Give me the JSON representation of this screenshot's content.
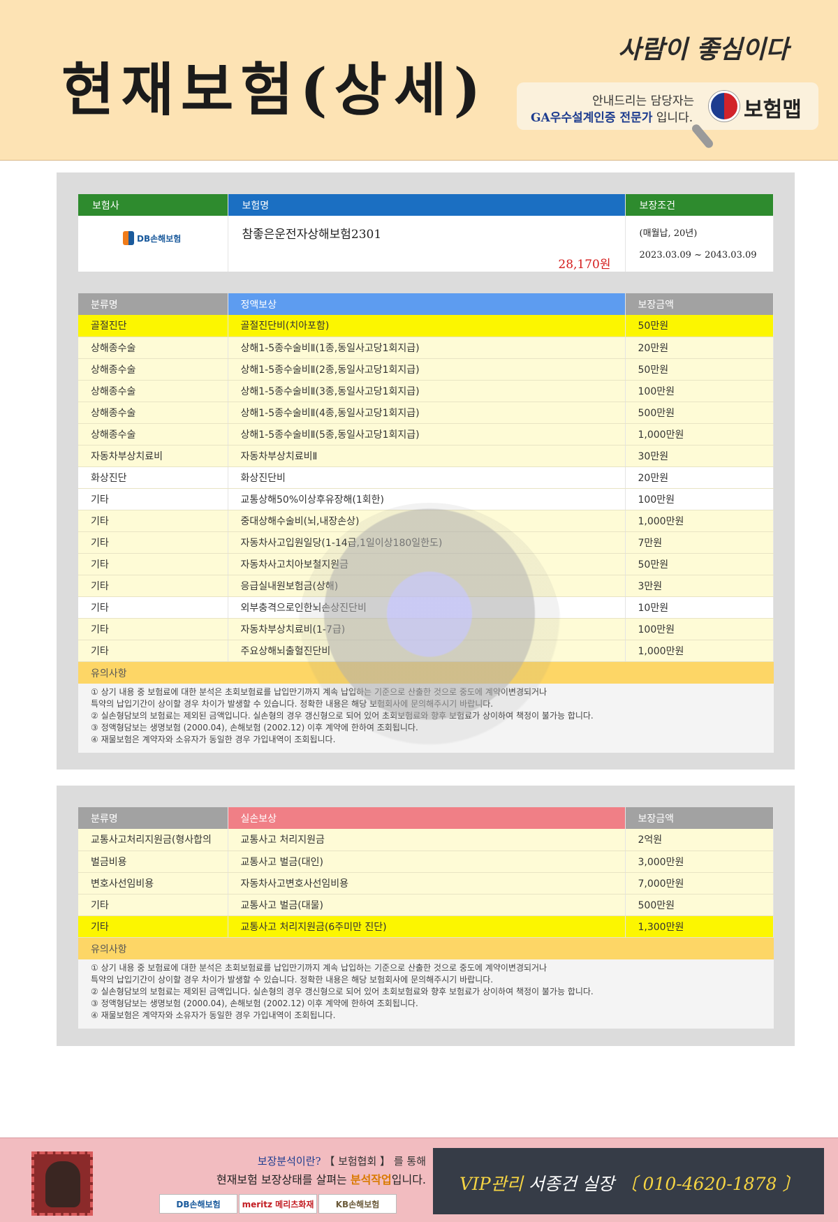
{
  "header": {
    "title": "현재보험(상세)",
    "slogan": "사람이 좋심이다",
    "agent_line1": "안내드리는 담당자는",
    "agent_line2_highlight": "GA우수설계인증 전문가",
    "agent_line2_tail": " 입니다.",
    "brand_name": "보험맵"
  },
  "policy": {
    "headers": {
      "company": "보험사",
      "product": "보험명",
      "terms": "보장조건"
    },
    "company_logo_text": "DB손해보험",
    "product_name": "참좋은운전자상해보험2301",
    "premium": "28,170원",
    "terms_payment": "(매월납, 20년)",
    "terms_period": "2023.03.09 ~ 2043.03.09"
  },
  "fixed_coverage": {
    "headers": {
      "category": "분류명",
      "coverage": "정액보상",
      "amount": "보장금액"
    },
    "rows": [
      {
        "category": "골절진단",
        "coverage": "골절진단비(치아포함)",
        "amount": "50만원",
        "style": "yellow"
      },
      {
        "category": "상해종수술",
        "coverage": "상해1-5종수술비Ⅱ(1종,동일사고당1회지급)",
        "amount": "20만원",
        "style": "light"
      },
      {
        "category": "상해종수술",
        "coverage": "상해1-5종수술비Ⅱ(2종,동일사고당1회지급)",
        "amount": "50만원",
        "style": "light"
      },
      {
        "category": "상해종수술",
        "coverage": "상해1-5종수술비Ⅱ(3종,동일사고당1회지급)",
        "amount": "100만원",
        "style": "light"
      },
      {
        "category": "상해종수술",
        "coverage": "상해1-5종수술비Ⅱ(4종,동일사고당1회지급)",
        "amount": "500만원",
        "style": "light"
      },
      {
        "category": "상해종수술",
        "coverage": "상해1-5종수술비Ⅱ(5종,동일사고당1회지급)",
        "amount": "1,000만원",
        "style": "light"
      },
      {
        "category": "자동차부상치료비",
        "coverage": "자동차부상치료비Ⅱ",
        "amount": "30만원",
        "style": "light"
      },
      {
        "category": "화상진단",
        "coverage": "화상진단비",
        "amount": "20만원",
        "style": "white"
      },
      {
        "category": "기타",
        "coverage": "교통상해50%이상후유장해(1회한)",
        "amount": "100만원",
        "style": "white"
      },
      {
        "category": "기타",
        "coverage": "중대상해수술비(뇌,내장손상)",
        "amount": "1,000만원",
        "style": "light"
      },
      {
        "category": "기타",
        "coverage": "자동차사고입원일당(1-14급,1일이상180일한도)",
        "amount": "7만원",
        "style": "light"
      },
      {
        "category": "기타",
        "coverage": "자동차사고치아보철지원금",
        "amount": "50만원",
        "style": "light"
      },
      {
        "category": "기타",
        "coverage": "응급실내원보험금(상해)",
        "amount": "3만원",
        "style": "light"
      },
      {
        "category": "기타",
        "coverage": "외부충격으로인한뇌손상진단비",
        "amount": "10만원",
        "style": "white"
      },
      {
        "category": "기타",
        "coverage": "자동차부상치료비(1-7급)",
        "amount": "100만원",
        "style": "light"
      },
      {
        "category": "기타",
        "coverage": "주요상해뇌출혈진단비",
        "amount": "1,000만원",
        "style": "light"
      }
    ],
    "notice_title": "유의사항",
    "notice_lines": [
      "① 상기 내용 중 보험료에 대한 분석은 초회보험료를 납입만기까지 계속 납입하는 기준으로 산출한 것으로 중도에 계약이변경되거나",
      "특약의 납입기간이 상이할 경우 차이가 발생할 수 있습니다. 정확한 내용은 해당 보험회사에 문의해주시기 바랍니다.",
      "② 실손형담보의 보험료는 제외된 금액입니다. 실손형의 경우 갱신형으로 되어 있어 초회보험료와 향후 보험료가 상이하여 책정이 불가능 합니다.",
      "③ 정액형담보는 생명보험 (2000.04), 손해보험 (2002.12) 이후 계약에 한하여 조회됩니다.",
      "④ 재물보험은 계약자와 소유자가 동일한 경우 가입내역이 조회됩니다."
    ]
  },
  "actual_coverage": {
    "headers": {
      "category": "분류명",
      "coverage": "실손보상",
      "amount": "보장금액"
    },
    "rows": [
      {
        "category": "교통사고처리지원금(형사합의",
        "coverage": "교통사고 처리지원금",
        "amount": "2억원",
        "style": "light"
      },
      {
        "category": "벌금비용",
        "coverage": "교통사고 벌금(대인)",
        "amount": "3,000만원",
        "style": "light"
      },
      {
        "category": "변호사선임비용",
        "coverage": "자동차사고변호사선임비용",
        "amount": "7,000만원",
        "style": "light"
      },
      {
        "category": "기타",
        "coverage": "교통사고 벌금(대물)",
        "amount": "500만원",
        "style": "light"
      },
      {
        "category": "기타",
        "coverage": "교통사고 처리지원금(6주미만 진단)",
        "amount": "1,300만원",
        "style": "yellow"
      }
    ],
    "notice_title": "유의사항",
    "notice_lines": [
      "① 상기 내용 중 보험료에 대한 분석은 초회보험료를 납입만기까지 계속 납입하는 기준으로 산출한 것으로 중도에 계약이변경되거나",
      "특약의 납입기간이 상이할 경우 차이가 발생할 수 있습니다. 정확한 내용은 해당 보험회사에 문의해주시기 바랍니다.",
      "② 실손형담보의 보험료는 제외된 금액입니다. 실손형의 경우 갱신형으로 되어 있어 초회보험료와 향후 보험료가 상이하여 책정이 불가능 합니다.",
      "③ 정액형담보는 생명보험 (2000.04), 손해보험 (2002.12) 이후 계약에 한하여 조회됩니다.",
      "④ 재물보험은 계약자와 소유자가 동일한 경우 가입내역이 조회됩니다."
    ]
  },
  "footer": {
    "line1_highlight": "보장분석이란?",
    "line1_tail": " 【 보험협회 】 를 통해",
    "line2_head": "현재보험 보장상태를 살펴는 ",
    "line2_highlight": "분석작업",
    "line2_tail": "입니다.",
    "partners": [
      "DB손해보험",
      "meritz 메리츠화재",
      "KB손해보험"
    ],
    "vip_label": "VIP관리 ",
    "vip_name": "서종건 실장",
    "vip_phone": " 〔 010-4620-1878 〕"
  }
}
